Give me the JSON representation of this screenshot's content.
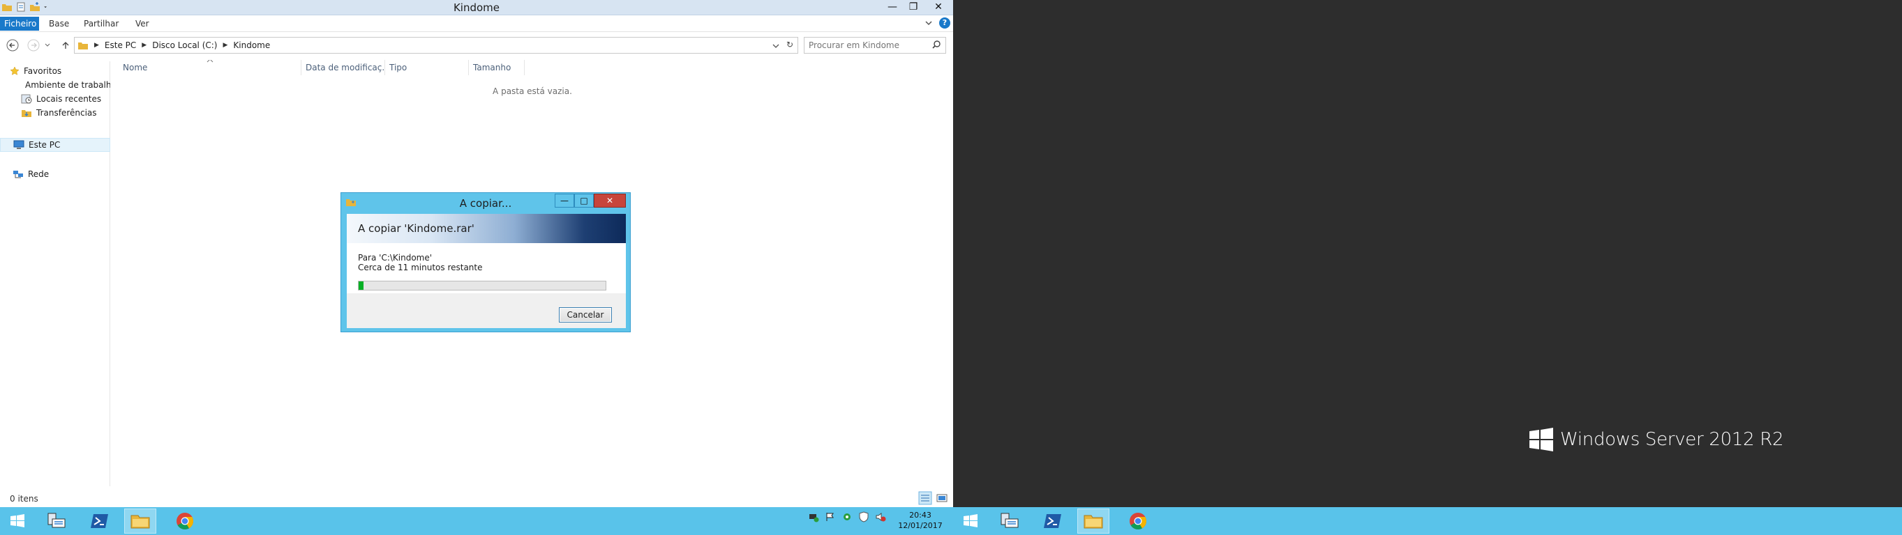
{
  "window": {
    "title": "Kindome",
    "controls": {
      "minimize": "—",
      "maximize": "❐",
      "close": "✕"
    }
  },
  "ribbon": {
    "tabs": [
      "Ficheiro",
      "Base",
      "Partilhar",
      "Ver"
    ],
    "help": "?"
  },
  "address": {
    "crumbs": [
      "Este PC",
      "Disco Local (C:)",
      "Kindome"
    ],
    "refresh": "↻"
  },
  "search": {
    "placeholder": "Procurar em Kindome"
  },
  "nav_pane": {
    "favorites": "Favoritos",
    "favorite_items": [
      "Ambiente de trabalho",
      "Locais recentes",
      "Transferências"
    ],
    "this_pc": "Este PC",
    "network": "Rede"
  },
  "columns": [
    "Nome",
    "Data de modificaç...",
    "Tipo",
    "Tamanho"
  ],
  "content": {
    "empty_message": "A pasta está vazia."
  },
  "status": {
    "items_count": "0 itens"
  },
  "taskbar": {
    "clock_time": "20:43",
    "clock_date": "12/01/2017"
  },
  "copy_dialog": {
    "title": "A copiar...",
    "header": "A copiar 'Kindome.rar'",
    "destination": "Para 'C:\\Kindome'",
    "remaining": "Cerca de 11 minutos restante",
    "progress_percent": 2,
    "cancel_label": "Cancelar",
    "controls": {
      "minimize": "—",
      "maximize": "□",
      "close": "✕"
    }
  },
  "desktop": {
    "brand_text": "Windows Server 2012 R2"
  },
  "colors": {
    "taskbar": "#59c3ea",
    "ribbon_file_tab": "#1979ca",
    "progress_fill": "#06b025",
    "dialog_close": "#c7453b",
    "desktop_background": "#2d2d2d"
  }
}
